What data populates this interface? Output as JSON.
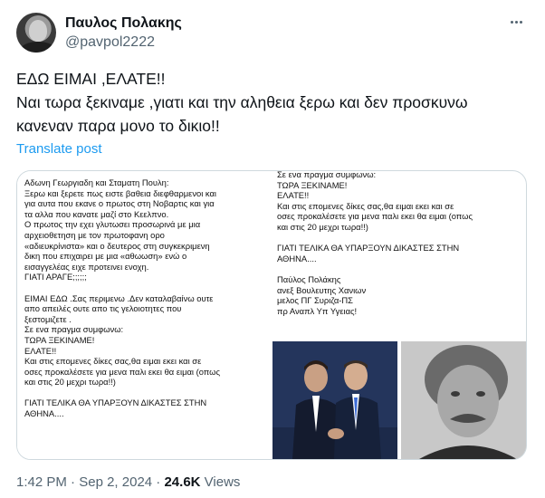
{
  "author": {
    "display_name": "Παυλος Πολακης",
    "handle": "@pavpol2222"
  },
  "tweet": {
    "lines": [
      "ΕΔΩ ΕΙΜΑΙ ,ΕΛΑΤΕ!!",
      "Ναι τωρα ξεκιναμε ,γιατι και την αληθεια ξερω και δεν προσκυνω",
      "κανεναν παρα μονο το δικιο!!"
    ],
    "translate_label": "Translate post"
  },
  "media": {
    "left_document": {
      "paragraph1": [
        "Αδωνη Γεωργιαδη και Σταματη Πουλη:",
        "Ξερω και ξερετε πως ειστε βαθεια  διεφθαρμενοι και",
        "για αυτα που εκανε ο πρωτος στη Νοβαρτις και για",
        "τα αλλα που κανατε μαζί στο Κεελπνο.",
        "Ο πρωτος την εχει γλυτωσει  προσωρινά με μια",
        "αρχειοθετηση με τον πρωτοφανη ορο",
        "«αδιευκρίνιστα» και ο δευτερος στη συγκεκριμενη",
        "δικη που επιχαιρει με μια «αθωωση» ενώ ο",
        "εισαγγελέας ειχε προτεινει ενοχη.",
        "ΓΙΑΤΙ ΑΡΑΓΕ;;;;;;"
      ],
      "paragraph2": [
        "ΕΙΜΑΙ ΕΔΩ .Σας περιμενω .Δεν καταλαβαίνω ουτε",
        "απο απειλές ουτε απο τις γελοιοτητες που",
        "ξεστομιζετε .",
        "Σε ενα πραγμα συμφωνω:",
        "ΤΩΡΑ ΞΕΚΙΝΑΜΕ!",
        "ΕΛΑΤΕ!!",
        "Και στις επομενες δίκες σας,θα ειμαι εκει και σε",
        "οσες προκαλέσετε για μενα παλι εκει  θα ειμαι (οπως",
        "και στις 20 μεχρι τωρα!!)"
      ],
      "paragraph3": [
        "ΓΙΑΤΙ ΤΕΛΙΚΑ ΘΑ ΥΠΑΡΞΟΥΝ ΔΙΚΑΣΤΕΣ ΣΤΗΝ",
        "ΑΘΗΝΑ...."
      ]
    },
    "right_document": {
      "paragraph1": [
        "Σε ενα πραγμα συμφωνω:",
        "ΤΩΡΑ ΞΕΚΙΝΑΜΕ!",
        "ΕΛΑΤΕ!!",
        "Και στις επομενες δίκες σας,θα ειμαι εκει και σε",
        "οσες προκαλέσετε για μενα παλι εκει  θα ειμαι (οπως",
        "και στις 20 μεχρι τωρα!!)"
      ],
      "paragraph2": [
        "ΓΙΑΤΙ ΤΕΛΙΚΑ ΘΑ ΥΠΑΡΞΟΥΝ ΔΙΚΑΣΤΕΣ ΣΤΗΝ",
        "ΑΘΗΝΑ...."
      ],
      "signature": [
        "Παύλος Πολάκης",
        " ανεξ Βουλευτης Χανιων",
        "μελος ΠΓ Συριζα-ΠΣ",
        "πρ Αναπλ Υπ Υγειας!"
      ]
    }
  },
  "meta": {
    "time": "1:42 PM",
    "separator": "·",
    "date": "Sep 2, 2024",
    "views_count": "24.6K",
    "views_label": "Views"
  },
  "colors": {
    "accent": "#1d9bf0",
    "secondary_text": "#536471",
    "border": "#cfd9de"
  }
}
